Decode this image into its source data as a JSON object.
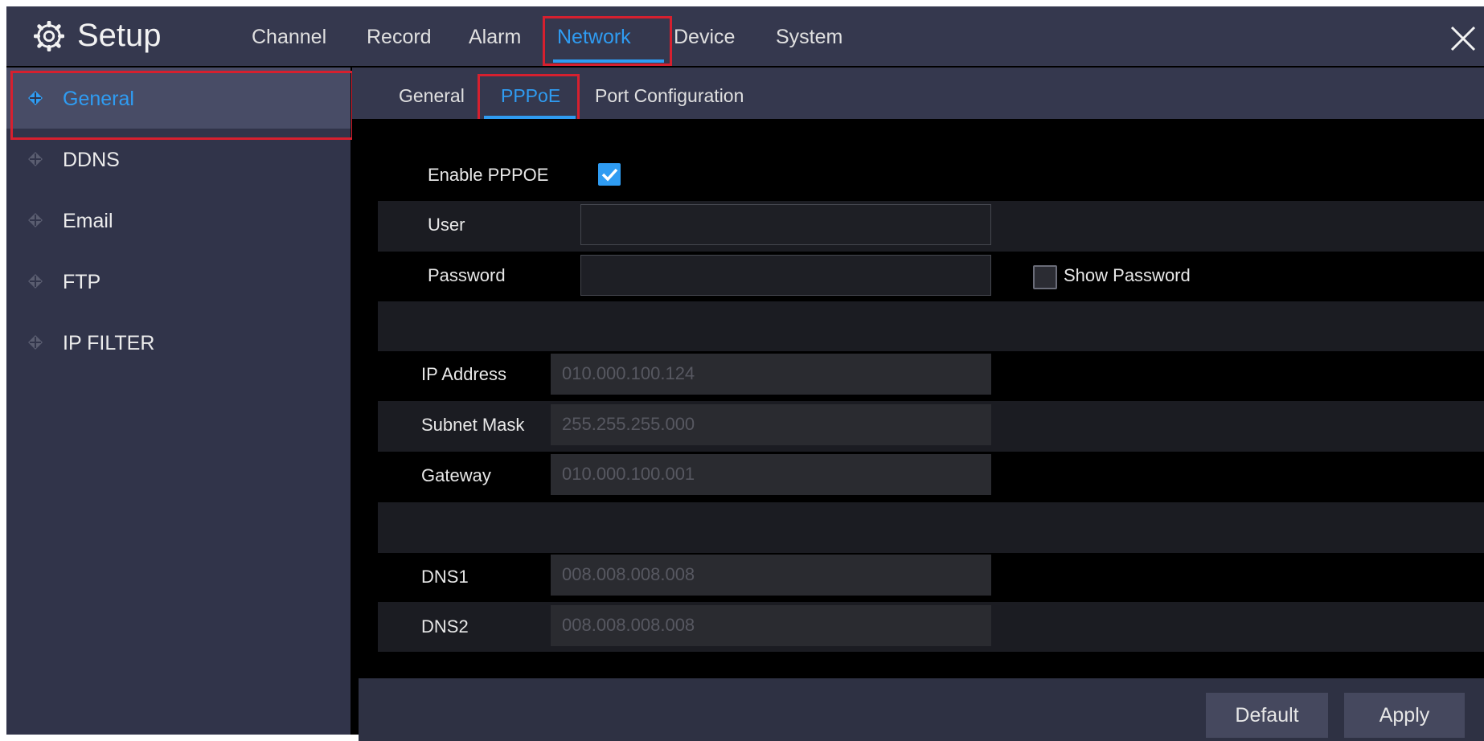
{
  "header": {
    "title": "Setup",
    "tabs": [
      {
        "label": "Channel"
      },
      {
        "label": "Record"
      },
      {
        "label": "Alarm"
      },
      {
        "label": "Network",
        "active": true
      },
      {
        "label": "Device"
      },
      {
        "label": "System"
      }
    ],
    "icons": {
      "settings": "gear-icon",
      "close": "close-icon"
    }
  },
  "sidebar": {
    "items": [
      {
        "label": "General",
        "active": true
      },
      {
        "label": "DDNS"
      },
      {
        "label": "Email"
      },
      {
        "label": "FTP"
      },
      {
        "label": "IP FILTER"
      }
    ]
  },
  "subtabs": [
    {
      "label": "General"
    },
    {
      "label": "PPPoE",
      "active": true
    },
    {
      "label": "Port Configuration"
    }
  ],
  "form": {
    "enable_pppoe": {
      "label": "Enable PPPOE",
      "checked": true
    },
    "user": {
      "label": "User",
      "value": ""
    },
    "password": {
      "label": "Password",
      "value": ""
    },
    "show_password": {
      "label": "Show Password",
      "checked": false
    },
    "ip_address": {
      "label": "IP Address",
      "value": "010.000.100.124"
    },
    "subnet_mask": {
      "label": "Subnet Mask",
      "value": "255.255.255.000"
    },
    "gateway": {
      "label": "Gateway",
      "value": "010.000.100.001"
    },
    "dns1": {
      "label": "DNS1",
      "value": "008.008.008.008"
    },
    "dns2": {
      "label": "DNS2",
      "value": "008.008.008.008"
    }
  },
  "buttons": {
    "default": "Default",
    "apply": "Apply"
  },
  "colors": {
    "accent": "#2f9cf2",
    "highlight_box": "#d6202f",
    "topbar": "#35384e",
    "sidebar": "#31344a"
  }
}
